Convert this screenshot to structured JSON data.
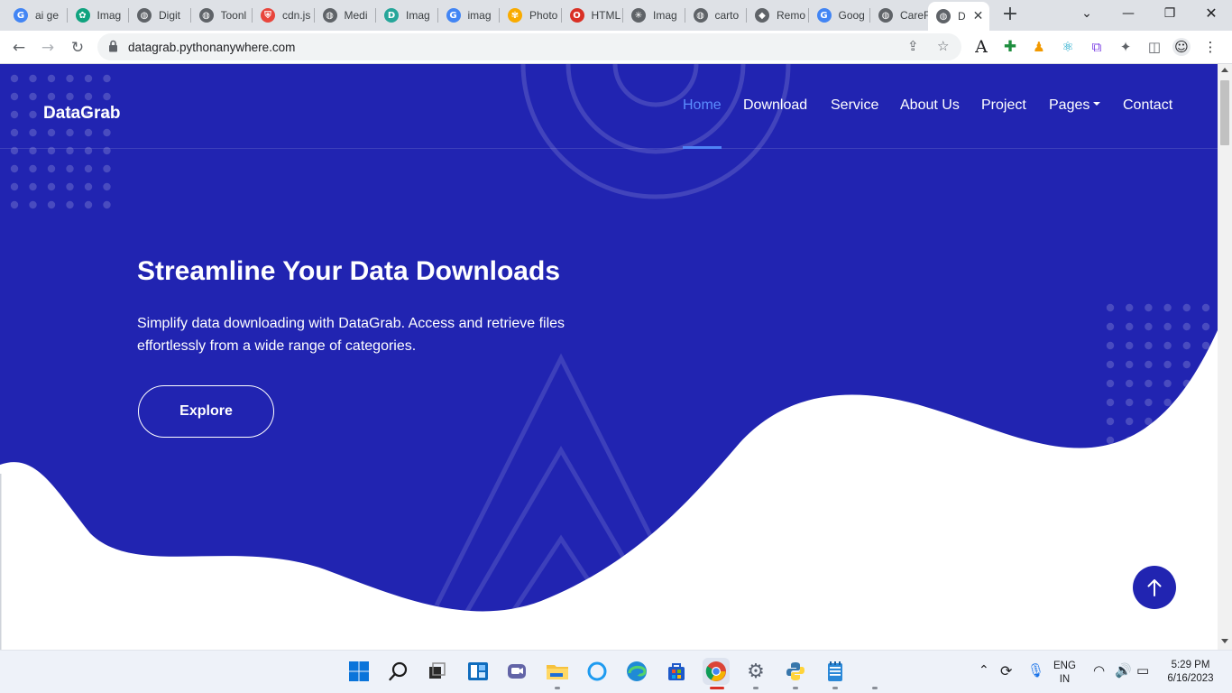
{
  "browser": {
    "tabs": [
      {
        "title": "ai ge",
        "icon": "google-icon",
        "color": "#4285f4"
      },
      {
        "title": "Imag",
        "icon": "chatgpt-icon",
        "color": "#10a37f"
      },
      {
        "title": "Digit",
        "icon": "globe-icon",
        "color": "#5f6368"
      },
      {
        "title": "Toonl",
        "icon": "globe-icon",
        "color": "#5f6368"
      },
      {
        "title": "cdn.js",
        "icon": "shield-icon",
        "color": "#e8453c"
      },
      {
        "title": "Medi",
        "icon": "globe-icon",
        "color": "#5f6368"
      },
      {
        "title": "Imag",
        "icon": "d-icon",
        "color": "#26a69a"
      },
      {
        "title": "imag",
        "icon": "google-icon",
        "color": "#4285f4"
      },
      {
        "title": "Photo",
        "icon": "photos-icon",
        "color": "#f9ab00"
      },
      {
        "title": "HTML",
        "icon": "opera-icon",
        "color": "#d93025"
      },
      {
        "title": "Imag",
        "icon": "bug-icon",
        "color": "#5f6368"
      },
      {
        "title": "carto",
        "icon": "globe-icon",
        "color": "#5f6368"
      },
      {
        "title": "Remo",
        "icon": "layers-icon",
        "color": "#5f6368"
      },
      {
        "title": "Goog",
        "icon": "google-icon",
        "color": "#4285f4"
      },
      {
        "title": "CareF",
        "icon": "globe-icon",
        "color": "#5f6368"
      }
    ],
    "active_tab": {
      "title": "D",
      "icon": "globe-icon"
    },
    "url": "datagrab.pythonanywhere.com"
  },
  "site": {
    "brand": "DataGrab",
    "nav": [
      {
        "label": "Home",
        "active": true
      },
      {
        "label": "Download"
      },
      {
        "label": "Service"
      },
      {
        "label": "About Us"
      },
      {
        "label": "Project"
      },
      {
        "label": "Pages"
      },
      {
        "label": "Contact"
      }
    ],
    "hero": {
      "title": "Streamline Your Data Downloads",
      "text": "Simplify data downloading with DataGrab. Access and retrieve files effortlessly from a wide range of categories.",
      "button": "Explore"
    },
    "colors": {
      "primary": "#2124b1",
      "accent": "#5b8dff",
      "white": "#ffffff"
    }
  },
  "taskbar": {
    "apps": [
      "start-icon",
      "search-icon",
      "task-view-icon",
      "widgets-icon",
      "teams-icon",
      "file-explorer-icon",
      "cortana-icon",
      "edge-icon",
      "store-icon",
      "chrome-icon",
      "settings-icon",
      "python-icon",
      "notepad-icon"
    ],
    "lang": "ENG",
    "region": "IN",
    "time": "5:29 PM",
    "date": "6/16/2023"
  }
}
